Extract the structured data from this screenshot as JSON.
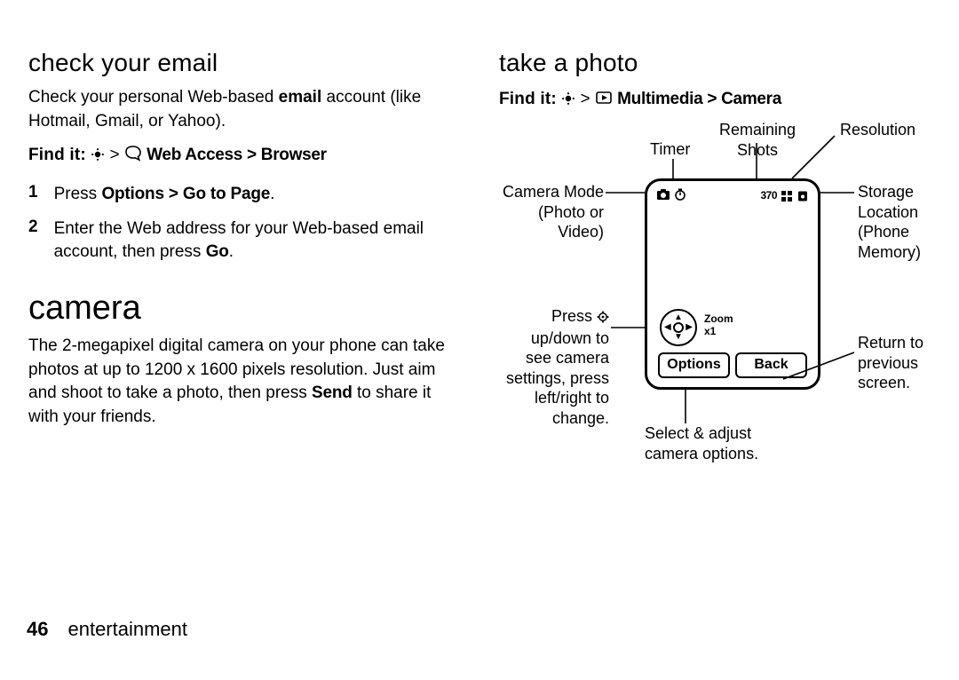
{
  "left": {
    "h_email": "check your email",
    "p_email_before": "Check your personal Web-based ",
    "p_email_bold": "email",
    "p_email_after": " account (like Hotmail, Gmail, or Yahoo).",
    "findit_label": "Find it:",
    "findit_path": "Web Access > Browser",
    "step1_n": "1",
    "step1_a": "Press ",
    "step1_b": "Options > Go to Page",
    "step1_c": ".",
    "step2_n": "2",
    "step2_a": "Enter the Web address for your Web-based email account, then press ",
    "step2_b": "Go",
    "step2_c": ".",
    "h_camera": "camera",
    "p_camera_a": "The 2-megapixel digital camera on your phone can take photos at up to 1200 x 1600 pixels resolution. Just aim and shoot to take a photo, then press ",
    "p_camera_b": "Send",
    "p_camera_c": " to share it with your friends."
  },
  "right": {
    "h_take": "take a photo",
    "findit_label": "Find it:",
    "findit_path": "Multimedia > Camera",
    "counter": "370",
    "zoom_label": "Zoom",
    "zoom_val": "x1",
    "btn_options": "Options",
    "btn_back": "Back",
    "callouts": {
      "timer": "Timer",
      "remaining": "Remaining",
      "shots": "Shots",
      "resolution": "Resolution",
      "mode_l1": "Camera Mode",
      "mode_l2": "(Photo or",
      "mode_l3": "Video)",
      "storage_l1": "Storage",
      "storage_l2": "Location",
      "storage_l3": "(Phone",
      "storage_l4": "Memory)",
      "press_l1": "Press ",
      "press_l2": "up/down to",
      "press_l3": "see camera",
      "press_l4": "settings, press",
      "press_l5": "left/right to",
      "press_l6": "change.",
      "return_l1": "Return to",
      "return_l2": "previous",
      "return_l3": "screen.",
      "select_l1": "Select & adjust",
      "select_l2": "camera options."
    }
  },
  "footer": {
    "page": "46",
    "section": "entertainment"
  }
}
